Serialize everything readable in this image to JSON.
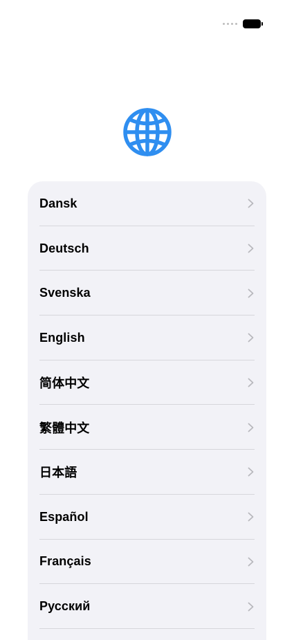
{
  "status_bar": {
    "signal_icon": "signal-dots-icon",
    "battery_icon": "battery-icon"
  },
  "header": {
    "icon": "globe-icon",
    "accent_color": "#2f8ef0"
  },
  "languages": [
    {
      "label": "Dansk"
    },
    {
      "label": "Deutsch"
    },
    {
      "label": "Svenska"
    },
    {
      "label": "English"
    },
    {
      "label": "简体中文"
    },
    {
      "label": "繁體中文"
    },
    {
      "label": "日本語"
    },
    {
      "label": "Español"
    },
    {
      "label": "Français"
    },
    {
      "label": "Русский"
    }
  ],
  "list_icon": "chevron-right-icon",
  "colors": {
    "card_background": "#f2f2f7",
    "separator": "#d6d6db",
    "chevron": "#b8b8bd"
  }
}
